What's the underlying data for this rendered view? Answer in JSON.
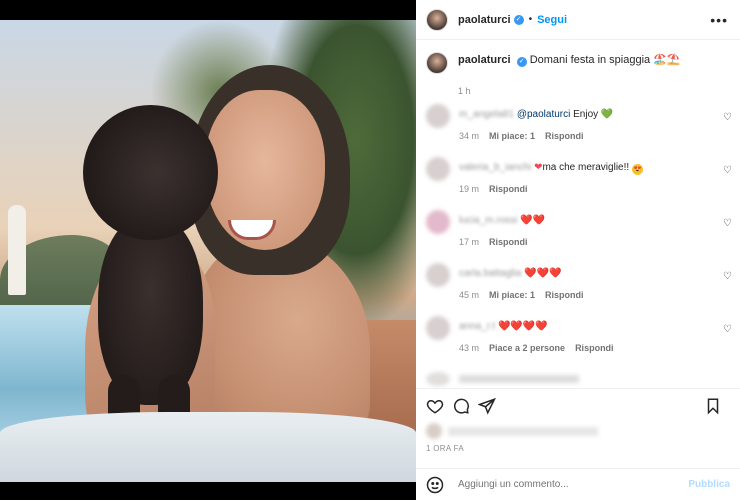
{
  "post": {
    "username": "paolaturci",
    "follow_label": "Segui",
    "dot": "•",
    "more": "•••",
    "caption": "Domani festa in spiaggia 🏖️⛱️",
    "caption_time": "1 h"
  },
  "comments": [
    {
      "user": "m_angela81",
      "mention": "@paolaturci",
      "text": " Enjoy ",
      "emoji": "💚",
      "time": "34 m",
      "likes": "Mi piace: 1",
      "reply": "Rispondi"
    },
    {
      "user": "valeria_b_ianchi",
      "text": "ma che meraviglie!! ",
      "emoji": "😍",
      "time": "19 m",
      "likes": "",
      "reply": "Rispondi"
    },
    {
      "user": "lucia_m.rossi",
      "text": "",
      "emoji": "❤️❤️",
      "time": "17 m",
      "likes": "",
      "reply": "Rispondi"
    },
    {
      "user": "carla.battaglia",
      "text": "",
      "emoji": "❤️❤️❤️",
      "time": "45 m",
      "likes": "Mi piace: 1",
      "reply": "Rispondi"
    },
    {
      "user": "anna_r.t",
      "text": "",
      "emoji": "❤️❤️❤️❤️",
      "time": "43 m",
      "likes": "Piace a 2 persone",
      "reply": "Rispondi"
    }
  ],
  "meta": {
    "post_time": "1 ORA FA"
  },
  "composer": {
    "placeholder": "Aggiungi un commento...",
    "submit": "Pubblica"
  },
  "colors": {
    "accent": "#0095f6",
    "heart": "#ed4956",
    "submit_disabled": "#b3dbff"
  },
  "icons": [
    "heart-icon",
    "comment-icon",
    "share-icon",
    "bookmark-icon",
    "emoji-icon",
    "verified-icon",
    "more-icon"
  ]
}
